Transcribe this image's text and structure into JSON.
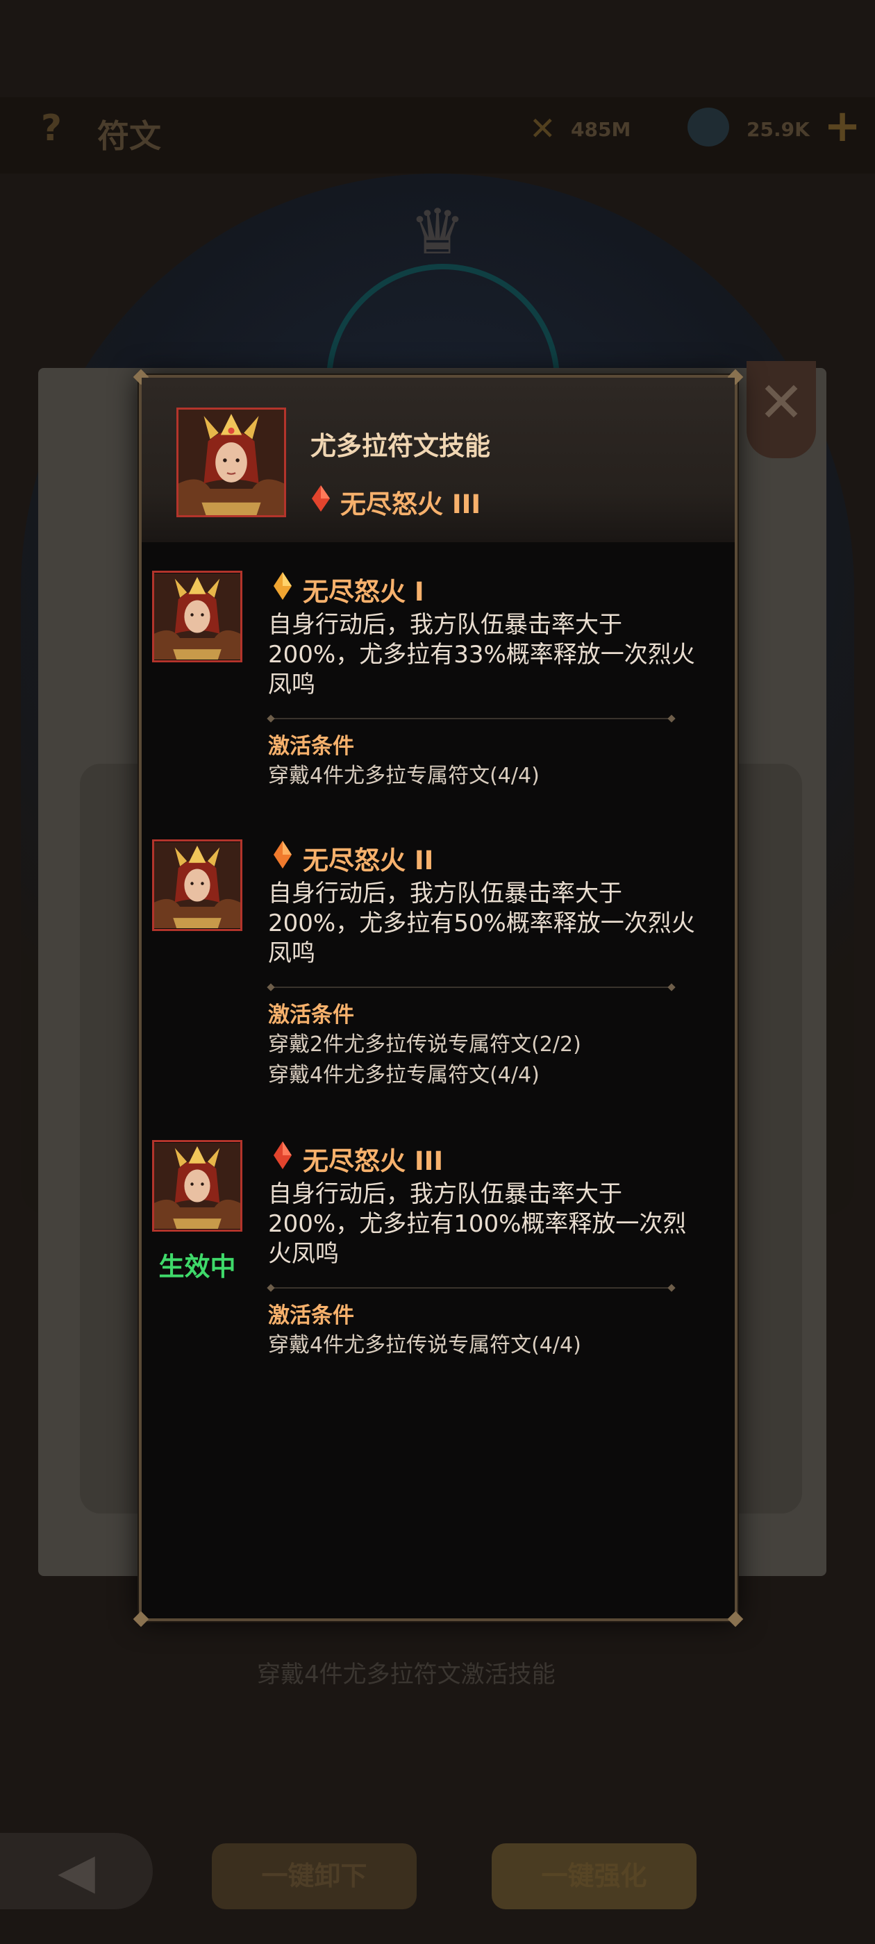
{
  "background": {
    "title": "符文",
    "resource_1": "485M",
    "resource_2": "25.9K",
    "footer_hint": "穿戴4件尤多拉符文激活技能",
    "btn_left": "一键卸下",
    "btn_right": "一键强化"
  },
  "popup": {
    "title": "尤多拉符文技能",
    "current_skill": "无尽怒火 III",
    "condition_label": "激活条件",
    "tiers": [
      {
        "name": "无尽怒火 I",
        "description": "自身行动后，我方队伍暴击率大于200%，尤多拉有33%概率释放一次烈火凤鸣",
        "conditions": [
          "穿戴4件尤多拉专属符文(4/4)"
        ],
        "status": ""
      },
      {
        "name": "无尽怒火 II",
        "description": "自身行动后，我方队伍暴击率大于200%，尤多拉有50%概率释放一次烈火凤鸣",
        "conditions": [
          "穿戴2件尤多拉传说专属符文(2/2)",
          "穿戴4件尤多拉专属符文(4/4)"
        ],
        "status": ""
      },
      {
        "name": "无尽怒火 III",
        "description": "自身行动后，我方队伍暴击率大于200%，尤多拉有100%概率释放一次烈火凤鸣",
        "conditions": [
          "穿戴4件尤多拉传说专属符文(4/4)"
        ],
        "status": "生效中"
      }
    ]
  },
  "colors": {
    "accent_orange": "#f7b16c",
    "active_green": "#3fd96a",
    "portrait_border": "#b3342b"
  }
}
